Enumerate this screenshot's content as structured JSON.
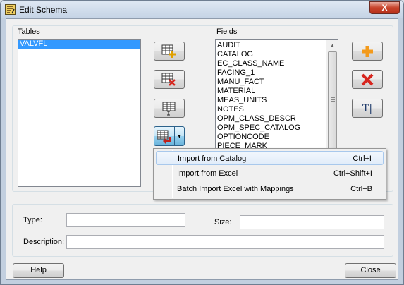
{
  "window": {
    "title": "Edit Schema",
    "close_glyph": "X"
  },
  "tables": {
    "label": "Tables",
    "items": [
      "VALVFL"
    ],
    "selected": "VALVFL"
  },
  "table_tools": {
    "add_table_icon": "table-add-icon",
    "delete_table_icon": "table-delete-icon",
    "edit_table_icon": "table-edit-icon",
    "import_icon": "table-import-icon",
    "dropdown_glyph": "▾"
  },
  "fields": {
    "label": "Fields",
    "items": [
      "AUDIT",
      "CATALOG",
      "EC_CLASS_NAME",
      "FACING_1",
      "MANU_FACT",
      "MATERIAL",
      "MEAS_UNITS",
      "NOTES",
      "OPM_CLASS_DESCR",
      "OPM_SPEC_CATALOG",
      "OPTIONCODE",
      "PIECE_MARK"
    ]
  },
  "field_tools": {
    "add_icon": "plus-icon",
    "delete_icon": "delete-x-icon",
    "rename_icon": "text-cursor-icon",
    "rename_text": "T"
  },
  "import_menu": {
    "items": [
      {
        "label": "Import from Catalog",
        "shortcut": "Ctrl+I"
      },
      {
        "label": "Import from Excel",
        "shortcut": "Ctrl+Shift+I"
      },
      {
        "label": "Batch Import Excel with Mappings",
        "shortcut": "Ctrl+B"
      }
    ],
    "highlighted_index": 0
  },
  "properties": {
    "type_label": "Type:",
    "type_value": "",
    "size_label": "Size:",
    "size_value": "",
    "description_label": "Description:",
    "description_value": ""
  },
  "footer": {
    "help_label": "Help",
    "close_label": "Close"
  },
  "colors": {
    "selection": "#3399ff",
    "delete_red": "#d7261f",
    "add_orange": "#f39a1b"
  }
}
